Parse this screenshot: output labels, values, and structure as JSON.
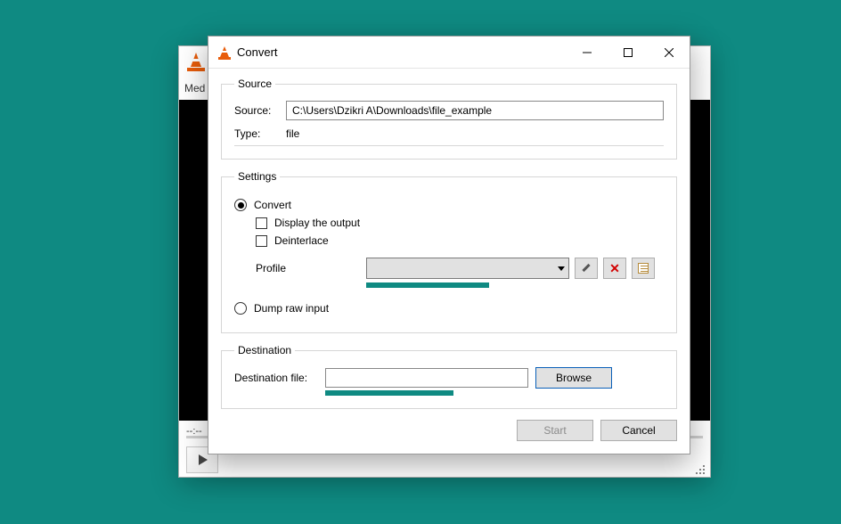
{
  "back_window": {
    "menu_first": "Med",
    "time_left": "--:--",
    "time_right": "--:--"
  },
  "dialog": {
    "title": "Convert",
    "source": {
      "legend": "Source",
      "source_label": "Source:",
      "source_value": "C:\\Users\\Dzikri A\\Downloads\\file_example",
      "type_label": "Type:",
      "type_value": "file"
    },
    "settings": {
      "legend": "Settings",
      "convert_label": "Convert",
      "display_output_label": "Display the output",
      "deinterlace_label": "Deinterlace",
      "profile_label": "Profile",
      "dump_label": "Dump raw input"
    },
    "destination": {
      "legend": "Destination",
      "dest_label": "Destination file:",
      "dest_value": "",
      "browse_label": "Browse"
    },
    "buttons": {
      "start": "Start",
      "cancel": "Cancel"
    }
  }
}
